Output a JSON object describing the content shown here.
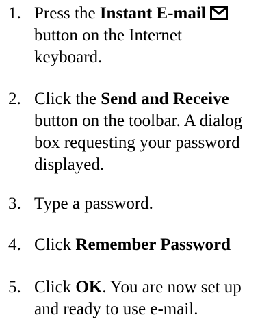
{
  "steps": [
    {
      "number": "1.",
      "line1_pre": "Press the ",
      "line1_bold": "Instant E-mail",
      "icon": "envelope-icon",
      "line2": "button on the Internet",
      "line3": "keyboard."
    },
    {
      "number": "2.",
      "line1_pre": "Click the ",
      "line1_bold": "Send and Receive",
      "line2": "button on the toolbar. A dialog",
      "line3": "box requesting your password",
      "line4": "displayed."
    },
    {
      "number": "3.",
      "line1": "Type a password."
    },
    {
      "number": "4.",
      "line1_pre": "Click ",
      "line1_bold": "Remember Password"
    },
    {
      "number": "5.",
      "line1_pre": "Click ",
      "line1_bold": "OK",
      "line1_post": ". You are now set up",
      "line2": "and ready to use e-mail."
    }
  ]
}
